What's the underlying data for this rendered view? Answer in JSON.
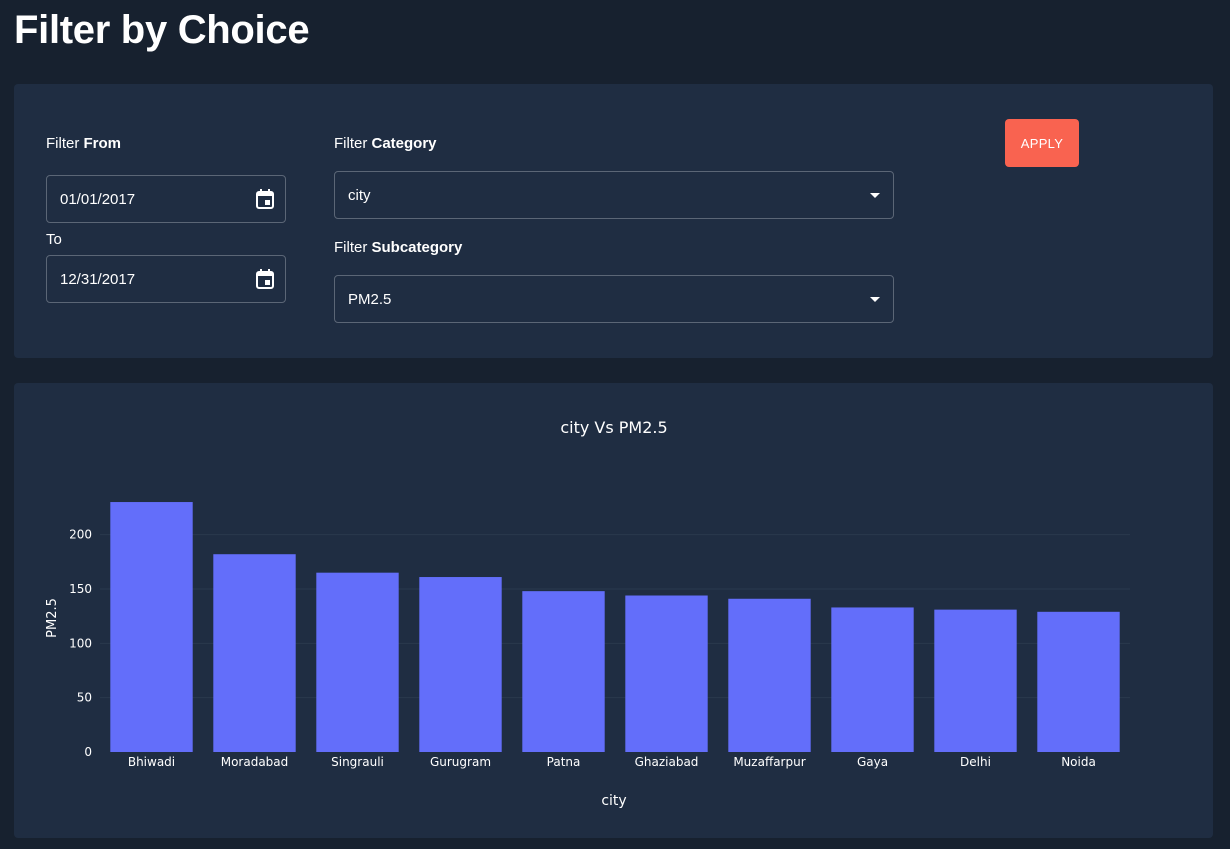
{
  "page": {
    "title": "Filter by Choice"
  },
  "filters": {
    "from_label_prefix": "Filter ",
    "from_label_bold": "From",
    "from_value": "01/01/2017",
    "to_label": "To",
    "to_value": "12/31/2017",
    "category_label_prefix": "Filter ",
    "category_label_bold": "Category",
    "category_value": "city",
    "subcategory_label_prefix": "Filter ",
    "subcategory_label_bold": "Subcategory",
    "subcategory_value": "PM2.5",
    "apply_label": "APPLY"
  },
  "colors": {
    "accent": "#f96350",
    "bar": "#636efa",
    "card": "#1f2d42",
    "background": "#17212f"
  },
  "chart_data": {
    "type": "bar",
    "title": "city Vs PM2.5",
    "xlabel": "city",
    "ylabel": "PM2.5",
    "categories": [
      "Bhiwadi",
      "Moradabad",
      "Singrauli",
      "Gurugram",
      "Patna",
      "Ghaziabad",
      "Muzaffarpur",
      "Gaya",
      "Delhi",
      "Noida"
    ],
    "values": [
      230,
      182,
      165,
      161,
      148,
      144,
      141,
      133,
      131,
      129
    ],
    "yticks": [
      0,
      50,
      100,
      150,
      200
    ],
    "ylim": [
      0,
      242
    ],
    "grid": true,
    "legend": false
  }
}
